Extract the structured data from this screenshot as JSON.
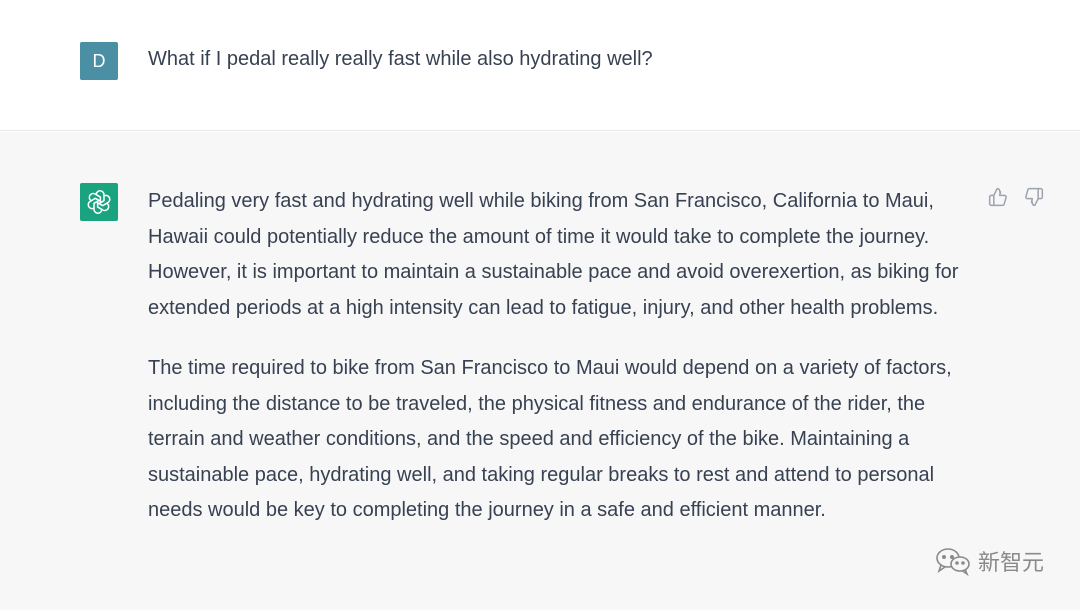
{
  "user": {
    "avatar_letter": "D",
    "message": "What if I pedal really really fast while also hydrating well?"
  },
  "assistant": {
    "icon": "openai-logo-icon",
    "paragraphs": [
      "Pedaling very fast and hydrating well while biking from San Francisco, California to Maui, Hawaii could potentially reduce the amount of time it would take to complete the journey. However, it is important to maintain a sustainable pace and avoid overexertion, as biking for extended periods at a high intensity can lead to fatigue, injury, and other health problems.",
      "The time required to bike from San Francisco to Maui would depend on a variety of factors, including the distance to be traveled, the physical fitness and endurance of the rider, the terrain and weather conditions, and the speed and efficiency of the bike. Maintaining a sustainable pace, hydrating well, and taking regular breaks to rest and attend to personal needs would be key to completing the journey in a safe and efficient manner."
    ]
  },
  "feedback": {
    "thumbs_up_icon": "thumbs-up-icon",
    "thumbs_down_icon": "thumbs-down-icon"
  },
  "watermark": {
    "text": "新智元",
    "icon": "wechat-icon"
  },
  "colors": {
    "user_avatar_bg": "#4a8fa3",
    "assistant_avatar_bg": "#19a37f",
    "assistant_bg": "#f7f7f8",
    "text": "#374151"
  }
}
